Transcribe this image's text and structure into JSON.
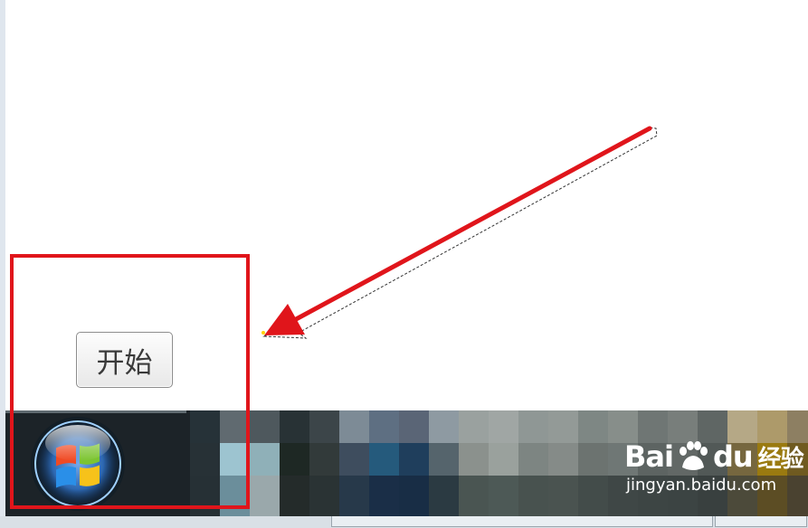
{
  "tooltip": {
    "label": "开始"
  },
  "taskbar": {
    "start_button": "windows-start-orb"
  },
  "colors": {
    "highlight": "#e0151b",
    "arrow": "#e0151b",
    "taskbar": "#1c2328"
  },
  "watermark": {
    "brand_a": "Bai",
    "brand_b": "du",
    "brand_cn": "经验",
    "url": "jingyan.baidu.com"
  }
}
